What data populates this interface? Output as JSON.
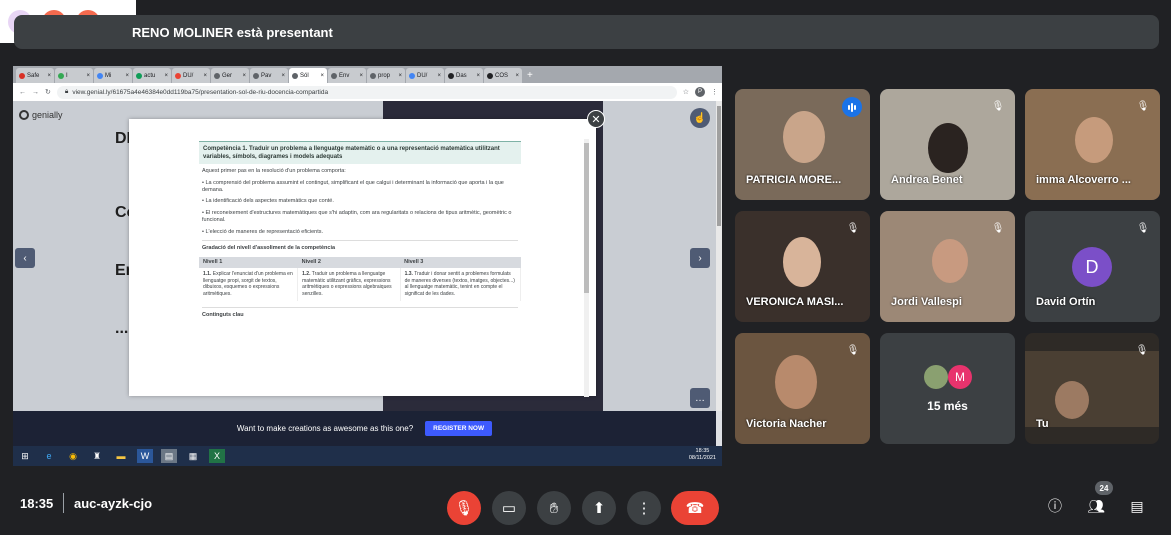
{
  "presenting_banner": "RENO MOLINER està presentant",
  "browser": {
    "tabs": [
      {
        "label": "Safe",
        "color": "#d93025"
      },
      {
        "label": "I",
        "color": "#34a853"
      },
      {
        "label": "Mi",
        "color": "#4285f4"
      },
      {
        "label": "actu",
        "color": "#0f9d58"
      },
      {
        "label": "DU/",
        "color": "#ea4335"
      },
      {
        "label": "Ger",
        "color": "#5f6368"
      },
      {
        "label": "Pav",
        "color": "#5f6368"
      },
      {
        "label": "Sól",
        "color": "#5f6368",
        "active": true
      },
      {
        "label": "Env",
        "color": "#5f6368"
      },
      {
        "label": "prop",
        "color": "#5f6368"
      },
      {
        "label": "DU/",
        "color": "#4285f4"
      },
      {
        "label": "Das",
        "color": "#202124"
      },
      {
        "label": "COS",
        "color": "#202124"
      }
    ],
    "url": "view.genial.ly/61675a4e46384e0dd119ba75/presentation-sol-de-riu-docencia-compartida",
    "profile_initial": "P"
  },
  "genially": {
    "logo": "genially",
    "behind_fragments": [
      "DI",
      "Co",
      "En",
      "..."
    ],
    "cta_text": "Want to make creations as awesome as this one?",
    "cta_button": "REGISTER NOW"
  },
  "document": {
    "heading": "Competència 1. Traduir un problema a llenguatge matemàtic o a una representació matemàtica utilitzant variables, símbols, diagrames i models adequats",
    "intro": "Aquest primer pas en la resolució d'un problema comporta:",
    "bullets": [
      "La comprensió del problema assumint el contingut, simplificant el que calgui i determinant la informació que aporta i la que demana.",
      "La identificació dels aspectes matemàtics que conté.",
      "El reconeixement d'estructures matemàtiques que s'hi adaptin, com ara regularitats o relacions de tipus aritmètic, geomètric o funcional.",
      "L'elecció de maneres de representació eficients."
    ],
    "gradation_title": "Gradació del nivell d'assoliment de la competència",
    "levels": [
      {
        "header": "Nivell 1",
        "num": "1.1.",
        "text": "Explicar l'enunciat d'un problema en llenguatge propi, sorgit de textos, dibuixos, esquemes o expressions aritmètiques."
      },
      {
        "header": "Nivell 2",
        "num": "1.2.",
        "text": "Traduir un problema a llenguatge matemàtic utilitzant gràfics, expressions aritmètiques o expressions algebraiques senzilles."
      },
      {
        "header": "Nivell 3",
        "num": "1.3.",
        "text": "Traduir i donar sentit a problemes formulats de maneres diverses (textos, imatges, objectes...) al llenguatge matemàtic, tenint en compte el significat de les dades."
      }
    ],
    "next_section": "Continguts clau"
  },
  "taskbar": {
    "time": "18:35",
    "date": "08/11/2021"
  },
  "participants": [
    {
      "name": "PATRICIA MORE...",
      "speaking": true,
      "muted": false
    },
    {
      "name": "Andrea Benet",
      "muted": true
    },
    {
      "name": "imma Alcoverro ...",
      "muted": true
    },
    {
      "name": "VERONICA MASI...",
      "muted": true
    },
    {
      "name": "Jordi Vallespi",
      "muted": true
    },
    {
      "name": "David Ortín",
      "muted": true,
      "initial": "D",
      "avatar_color": "#7b4fc8"
    },
    {
      "name": "Victoria Nacher",
      "muted": true
    },
    {
      "name": "15 més",
      "initial": "M",
      "avatar_color": "#e8336d"
    },
    {
      "name": "Tu",
      "muted": true
    }
  ],
  "meeting": {
    "time": "18:35",
    "code": "auc-ayzk-cjo",
    "participant_count": "24"
  },
  "colors": {
    "background": "#202124",
    "control": "#3c4043",
    "danger": "#ea4335",
    "accent": "#1a73e8"
  }
}
